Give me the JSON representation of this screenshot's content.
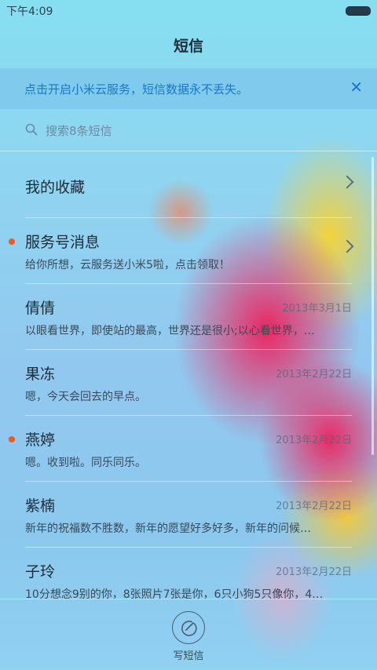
{
  "status_bar": {
    "time": "下午4:09"
  },
  "title": "短信",
  "banner": {
    "text": "点击开启小米云服务，短信数据永不丢失。",
    "close_icon": "close-icon"
  },
  "search": {
    "placeholder": "搜索8条短信"
  },
  "favorites": {
    "label": "我的收藏"
  },
  "conversations": [
    {
      "name": "服务号消息",
      "snippet": "给你所想，云服务送小米5啦，点击领取！",
      "date": "",
      "unread": true
    },
    {
      "name": "倩倩",
      "snippet": "以眼看世界，即使站的最高，世界还是很小;以心看世界，…",
      "date": "2013年3月1日",
      "unread": false
    },
    {
      "name": "果冻",
      "snippet": "嗯，今天会回去的早点。",
      "date": "2013年2月22日",
      "unread": false
    },
    {
      "name": "燕婷",
      "snippet": "嗯。收到啦。同乐同乐。",
      "date": "2013年2月22日",
      "unread": true
    },
    {
      "name": "紫楠",
      "snippet": "新年的祝福数不胜数，新年的愿望好多好多，新年的问候…",
      "date": "2013年2月22日",
      "unread": false
    },
    {
      "name": "子玲",
      "snippet": "10分想念9别的你，8张照片7张是你，6只小狗5只像你，4…",
      "date": "2013年2月22日",
      "unread": false
    }
  ],
  "compose": {
    "label": "写短信",
    "icon": "compose-icon"
  },
  "colors": {
    "accent": "#1a78c8",
    "unread_dot": "#ee5a20"
  }
}
